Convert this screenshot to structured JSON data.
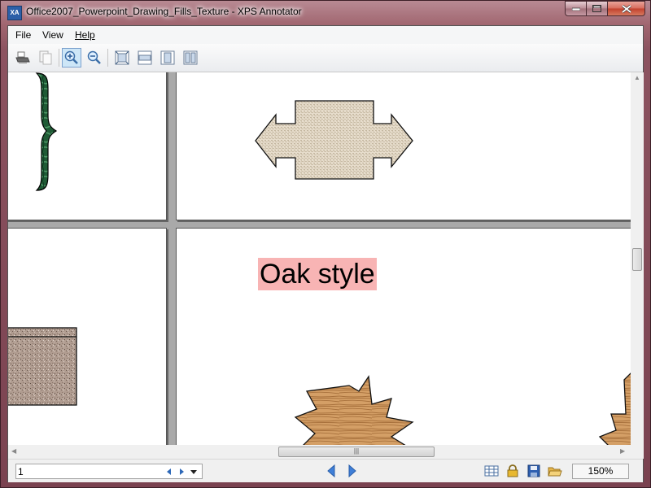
{
  "window": {
    "title": "Office2007_Powerpoint_Drawing_Fills_Texture - XPS Annotator",
    "icon_text": "XA",
    "icon": "xps-annotator-app-icon",
    "controls": [
      "minimize-icon",
      "maximize-icon",
      "close-icon"
    ]
  },
  "menu": {
    "items": [
      {
        "label": "File"
      },
      {
        "label": "View"
      },
      {
        "label": "Help"
      }
    ]
  },
  "toolbar": {
    "buttons": [
      {
        "icon": "print-icon"
      },
      {
        "icon": "copy-icon"
      },
      {
        "icon": "zoom-in-icon",
        "active": true
      },
      {
        "icon": "zoom-out-icon"
      },
      {
        "icon": "actual-size-icon"
      },
      {
        "icon": "fit-width-icon"
      },
      {
        "icon": "whole-page-icon"
      },
      {
        "icon": "two-pages-icon"
      }
    ]
  },
  "document": {
    "text_block": "Oak style",
    "highlight_color": "#f8b4b4",
    "textures": [
      "green-marble",
      "burlap",
      "granite",
      "oak"
    ]
  },
  "status": {
    "page_number": "1",
    "zoom": "150%",
    "icons": [
      "page-prev-icon",
      "page-next-icon",
      "page-dropdown-icon",
      "nav-back-icon",
      "nav-forward-icon",
      "thumbnails-icon",
      "lock-icon",
      "save-icon",
      "open-folder-icon"
    ]
  },
  "colors": {
    "nav_arrow": "#3f7fd8",
    "viewer_background": "#a9a9a9",
    "window_frame": "#8c5360"
  }
}
